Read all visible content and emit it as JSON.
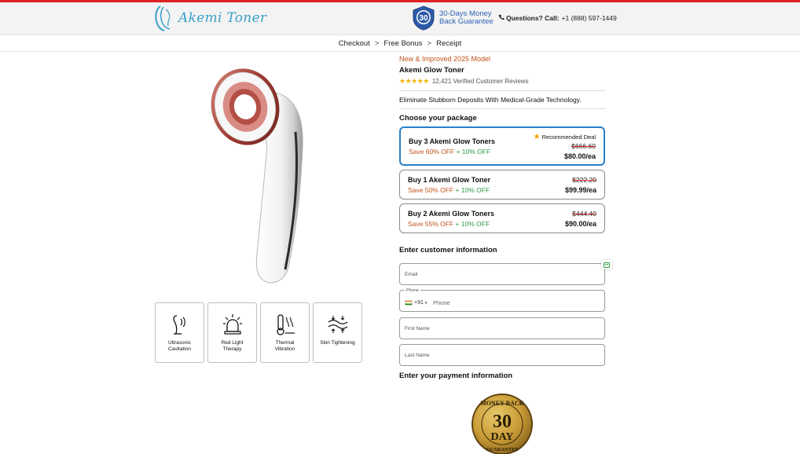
{
  "header": {
    "logo_text": "Akemi Toner",
    "guarantee_badge_number": "30",
    "guarantee_line1": "30-Days Money",
    "guarantee_line2": "Back Guarantee",
    "questions_label": "Questions? Call:",
    "phone": "+1 (888) 597-1449"
  },
  "breadcrumb": {
    "items": [
      "Checkout",
      "Free Bonus",
      "Receipt"
    ],
    "separator": ">"
  },
  "features": [
    {
      "label_line1": "Ultrasonic",
      "label_line2": "Cavitation",
      "icon": "ultrasonic-icon"
    },
    {
      "label_line1": "Red Light",
      "label_line2": "Therapy",
      "icon": "red-light-icon"
    },
    {
      "label_line1": "Thermal",
      "label_line2": "Vibration",
      "icon": "thermal-icon"
    },
    {
      "label_line1": "Skin Tightening",
      "label_line2": "",
      "icon": "skin-tightening-icon"
    }
  ],
  "product": {
    "model_tag": "New & Improved 2025 Model",
    "title": "Akemi Glow Toner",
    "stars": "★★★★★",
    "reviews": "12,421 Verified Customer Reviews",
    "tagline": "Eliminate Stubborn Deposits With Medical-Grade Technology."
  },
  "packages": {
    "title": "Choose your package",
    "recommended_label": "Recommended Deal",
    "items": [
      {
        "name": "Buy 3 Akemi Glow Toners",
        "save": "Save 60% OFF",
        "extra": "+ 10% OFF",
        "old_price": "$666.60",
        "price": "$80.00/ea",
        "selected": true
      },
      {
        "name": "Buy 1 Akemi Glow Toner",
        "save": "Save 50% OFF",
        "extra": "+ 10% OFF",
        "old_price": "$222.20",
        "price": "$99.99/ea",
        "selected": false
      },
      {
        "name": "Buy 2 Akemi Glow Toners",
        "save": "Save 55% OFF",
        "extra": "+ 10% OFF",
        "old_price": "$444.40",
        "price": "$90.00/ea",
        "selected": false
      }
    ]
  },
  "customer": {
    "title": "Enter customer information",
    "email_placeholder": "Email",
    "phone_label": "Phone",
    "phone_code": "+91",
    "phone_placeholder": "Phone",
    "first_name_placeholder": "First Name",
    "last_name_placeholder": "Last Name"
  },
  "payment": {
    "title": "Enter your payment information",
    "badge_top": "MONEY BACK",
    "badge_number": "30",
    "badge_day": "DAY",
    "badge_bottom": "GUARANTEE"
  },
  "colors": {
    "accent_red": "#e02020",
    "orange": "#c0531b",
    "green": "#2e9a43",
    "selected_border": "#2a7fc7",
    "guarantee_blue": "#2d63b5"
  }
}
